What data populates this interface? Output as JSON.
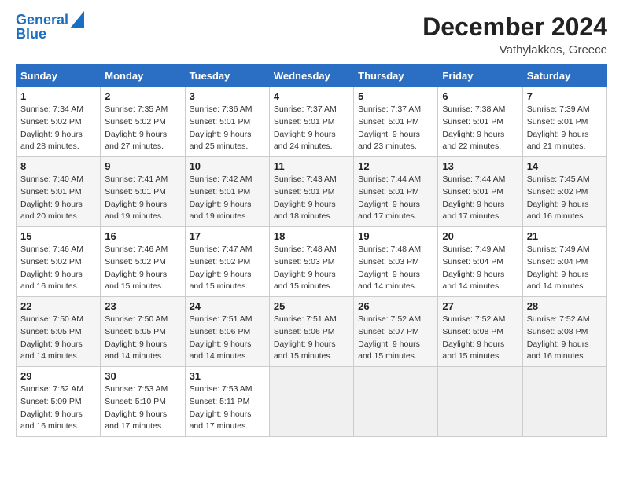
{
  "header": {
    "logo_line1": "General",
    "logo_line2": "Blue",
    "month": "December 2024",
    "location": "Vathylakkos, Greece"
  },
  "days_of_week": [
    "Sunday",
    "Monday",
    "Tuesday",
    "Wednesday",
    "Thursday",
    "Friday",
    "Saturday"
  ],
  "weeks": [
    [
      {
        "day": 1,
        "sunrise": "7:34 AM",
        "sunset": "5:02 PM",
        "daylight": "9 hours and 28 minutes."
      },
      {
        "day": 2,
        "sunrise": "7:35 AM",
        "sunset": "5:02 PM",
        "daylight": "9 hours and 27 minutes."
      },
      {
        "day": 3,
        "sunrise": "7:36 AM",
        "sunset": "5:01 PM",
        "daylight": "9 hours and 25 minutes."
      },
      {
        "day": 4,
        "sunrise": "7:37 AM",
        "sunset": "5:01 PM",
        "daylight": "9 hours and 24 minutes."
      },
      {
        "day": 5,
        "sunrise": "7:37 AM",
        "sunset": "5:01 PM",
        "daylight": "9 hours and 23 minutes."
      },
      {
        "day": 6,
        "sunrise": "7:38 AM",
        "sunset": "5:01 PM",
        "daylight": "9 hours and 22 minutes."
      },
      {
        "day": 7,
        "sunrise": "7:39 AM",
        "sunset": "5:01 PM",
        "daylight": "9 hours and 21 minutes."
      }
    ],
    [
      {
        "day": 8,
        "sunrise": "7:40 AM",
        "sunset": "5:01 PM",
        "daylight": "9 hours and 20 minutes."
      },
      {
        "day": 9,
        "sunrise": "7:41 AM",
        "sunset": "5:01 PM",
        "daylight": "9 hours and 19 minutes."
      },
      {
        "day": 10,
        "sunrise": "7:42 AM",
        "sunset": "5:01 PM",
        "daylight": "9 hours and 19 minutes."
      },
      {
        "day": 11,
        "sunrise": "7:43 AM",
        "sunset": "5:01 PM",
        "daylight": "9 hours and 18 minutes."
      },
      {
        "day": 12,
        "sunrise": "7:44 AM",
        "sunset": "5:01 PM",
        "daylight": "9 hours and 17 minutes."
      },
      {
        "day": 13,
        "sunrise": "7:44 AM",
        "sunset": "5:01 PM",
        "daylight": "9 hours and 17 minutes."
      },
      {
        "day": 14,
        "sunrise": "7:45 AM",
        "sunset": "5:02 PM",
        "daylight": "9 hours and 16 minutes."
      }
    ],
    [
      {
        "day": 15,
        "sunrise": "7:46 AM",
        "sunset": "5:02 PM",
        "daylight": "9 hours and 16 minutes."
      },
      {
        "day": 16,
        "sunrise": "7:46 AM",
        "sunset": "5:02 PM",
        "daylight": "9 hours and 15 minutes."
      },
      {
        "day": 17,
        "sunrise": "7:47 AM",
        "sunset": "5:02 PM",
        "daylight": "9 hours and 15 minutes."
      },
      {
        "day": 18,
        "sunrise": "7:48 AM",
        "sunset": "5:03 PM",
        "daylight": "9 hours and 15 minutes."
      },
      {
        "day": 19,
        "sunrise": "7:48 AM",
        "sunset": "5:03 PM",
        "daylight": "9 hours and 14 minutes."
      },
      {
        "day": 20,
        "sunrise": "7:49 AM",
        "sunset": "5:04 PM",
        "daylight": "9 hours and 14 minutes."
      },
      {
        "day": 21,
        "sunrise": "7:49 AM",
        "sunset": "5:04 PM",
        "daylight": "9 hours and 14 minutes."
      }
    ],
    [
      {
        "day": 22,
        "sunrise": "7:50 AM",
        "sunset": "5:05 PM",
        "daylight": "9 hours and 14 minutes."
      },
      {
        "day": 23,
        "sunrise": "7:50 AM",
        "sunset": "5:05 PM",
        "daylight": "9 hours and 14 minutes."
      },
      {
        "day": 24,
        "sunrise": "7:51 AM",
        "sunset": "5:06 PM",
        "daylight": "9 hours and 14 minutes."
      },
      {
        "day": 25,
        "sunrise": "7:51 AM",
        "sunset": "5:06 PM",
        "daylight": "9 hours and 15 minutes."
      },
      {
        "day": 26,
        "sunrise": "7:52 AM",
        "sunset": "5:07 PM",
        "daylight": "9 hours and 15 minutes."
      },
      {
        "day": 27,
        "sunrise": "7:52 AM",
        "sunset": "5:08 PM",
        "daylight": "9 hours and 15 minutes."
      },
      {
        "day": 28,
        "sunrise": "7:52 AM",
        "sunset": "5:08 PM",
        "daylight": "9 hours and 16 minutes."
      }
    ],
    [
      {
        "day": 29,
        "sunrise": "7:52 AM",
        "sunset": "5:09 PM",
        "daylight": "9 hours and 16 minutes."
      },
      {
        "day": 30,
        "sunrise": "7:53 AM",
        "sunset": "5:10 PM",
        "daylight": "9 hours and 17 minutes."
      },
      {
        "day": 31,
        "sunrise": "7:53 AM",
        "sunset": "5:11 PM",
        "daylight": "9 hours and 17 minutes."
      },
      null,
      null,
      null,
      null
    ]
  ]
}
